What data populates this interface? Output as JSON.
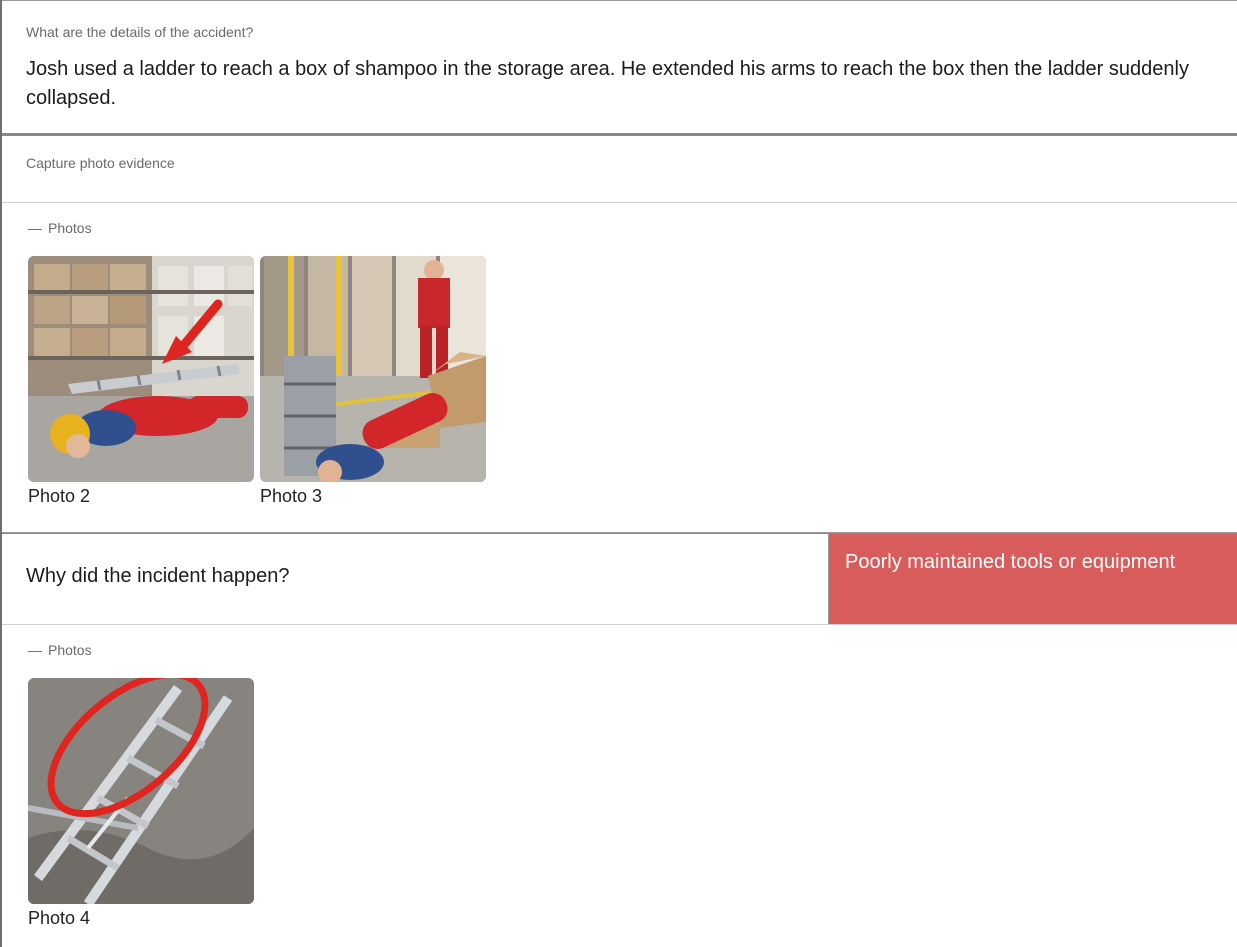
{
  "details": {
    "label": "What are the details of the accident?",
    "answer": "Josh used a ladder to reach a box of shampoo in the storage area. He extended his arms to reach the box then the ladder suddenly collapsed."
  },
  "capture": {
    "label": "Capture photo evidence"
  },
  "photos_section_1": {
    "dash": "—",
    "label": "Photos",
    "items": [
      {
        "caption": "Photo 2",
        "icon": "photo-thumbnail"
      },
      {
        "caption": "Photo 3",
        "icon": "photo-thumbnail"
      }
    ]
  },
  "why": {
    "question": "Why did the incident happen?",
    "response": "Poorly maintained tools or equipment",
    "response_color": "#d95c5c"
  },
  "photos_section_2": {
    "dash": "—",
    "label": "Photos",
    "items": [
      {
        "caption": "Photo 4",
        "icon": "photo-thumbnail"
      }
    ]
  }
}
